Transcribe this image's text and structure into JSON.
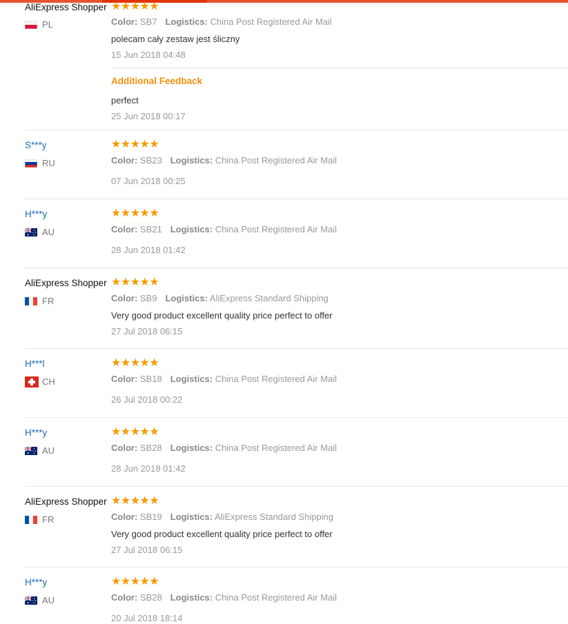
{
  "labels": {
    "color": "Color:",
    "logistics": "Logistics:",
    "additional_feedback": "Additional Feedback"
  },
  "rating_stars": "★★★★★",
  "reviews": [
    {
      "user": "AliExpress Shopper",
      "country": "PL",
      "flag": "pl-flag-icon",
      "color": "SB7",
      "logistics": "China Post Registered Air Mail",
      "text": "polecam cały zestaw jest śliczny",
      "date": "15 Jun 2018 04:48",
      "additional": {
        "text": "perfect",
        "date": "25 Jun 2018 00:17"
      }
    },
    {
      "user": "S***y",
      "country": "RU",
      "flag": "ru-flag-icon",
      "color": "SB23",
      "logistics": "China Post Registered Air Mail",
      "date": "07 Jun 2018 00:25"
    },
    {
      "user": "H***y",
      "country": "AU",
      "flag": "au-flag-icon",
      "color": "SB21",
      "logistics": "China Post Registered Air Mail",
      "date": "28 Jun 2018 01:42"
    },
    {
      "user": "AliExpress Shopper",
      "country": "FR",
      "flag": "fr-flag-icon",
      "color": "SB9",
      "logistics": "AliExpress Standard Shipping",
      "text": "Very good product excellent quality price perfect to offer",
      "date": "27 Jul 2018 06:15"
    },
    {
      "user": "H***l",
      "country": "CH",
      "flag": "ch-flag-icon",
      "color": "SB18",
      "logistics": "China Post Registered Air Mail",
      "date": "26 Jul 2018 00:22"
    },
    {
      "user": "H***y",
      "country": "AU",
      "flag": "au-flag-icon",
      "color": "SB28",
      "logistics": "China Post Registered Air Mail",
      "date": "28 Jun 2018 01:42"
    },
    {
      "user": "AliExpress Shopper",
      "country": "FR",
      "flag": "fr-flag-icon",
      "color": "SB19",
      "logistics": "AliExpress Standard Shipping",
      "text": "Very good product excellent quality price perfect to offer",
      "date": "27 Jul 2018 06:15"
    },
    {
      "user": "H***y",
      "country": "AU",
      "flag": "au-flag-icon",
      "color": "SB28",
      "logistics": "China Post Registered Air Mail",
      "date": "20 Jul 2018 18:14"
    }
  ],
  "colors": {
    "accent": "#e55630",
    "stars": "#f59b00",
    "username_link": "#1a6bb5",
    "additional_feedback": "#f2900e"
  }
}
